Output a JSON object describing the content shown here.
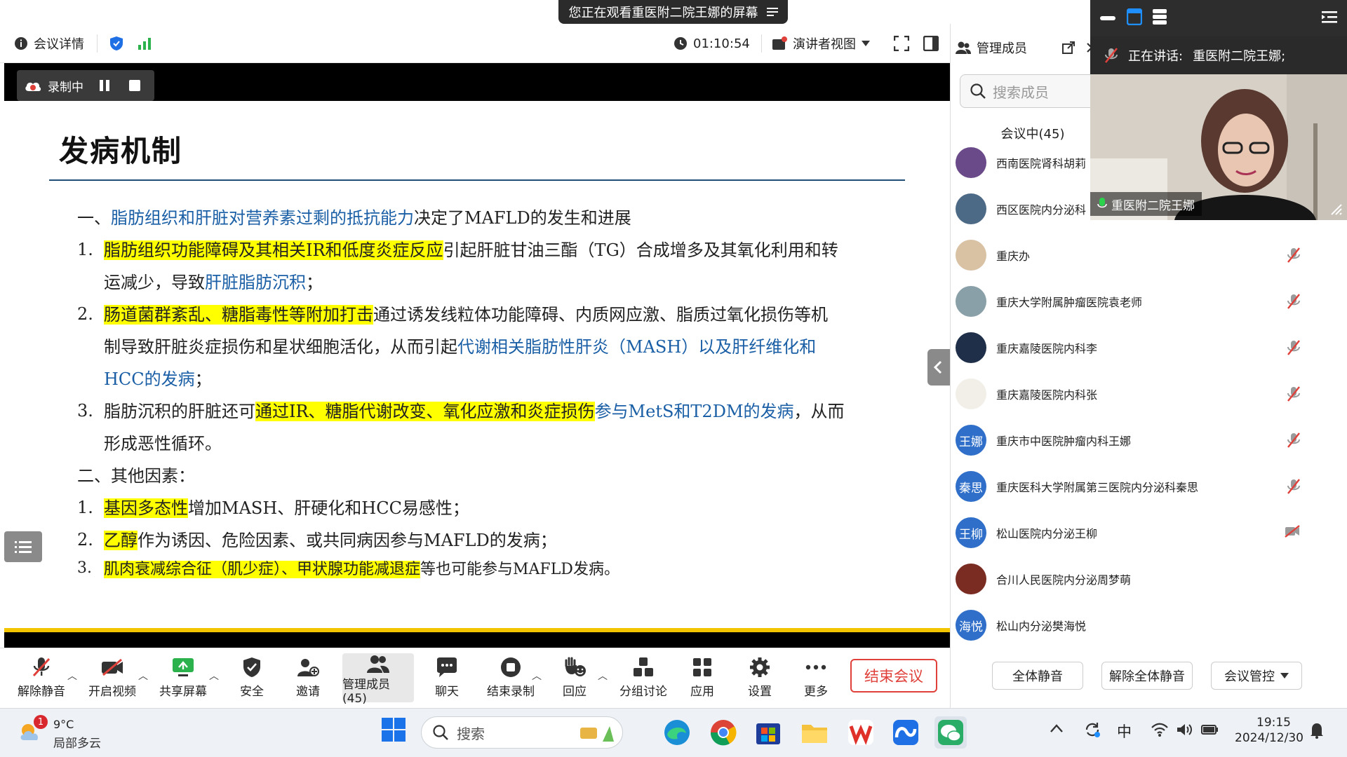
{
  "banner": {
    "text": "您正在观看重医附二院王娜的屏幕"
  },
  "topbar": {
    "meeting_info": "会议详情",
    "timer": "01:10:54",
    "view_mode": "演讲者视图"
  },
  "recording": {
    "label": "录制中"
  },
  "slide": {
    "title": "发病机制",
    "lines": {
      "s1_prefix": "一、",
      "s1_blue": "脂肪组织和肝脏对营养素过剩的抵抗能力",
      "s1_rest": "决定了MAFLD的发生和进展",
      "n1": "1.",
      "l1_hl": "脂肪组织功能障碍及其相关IR和低度炎症反应",
      "l1_rest": "引起肝脏甘油三酯（TG）合成增多及其氧化利用和转",
      "l1b_a": "运减少，导致",
      "l1b_blue": "肝脏脂肪沉积",
      "l1b_b": "；",
      "n2": "2.",
      "l2_hl": "肠道菌群紊乱、糖脂毒性等附加打击",
      "l2_rest": "通过诱发线粒体功能障碍、内质网应激、脂质过氧化损伤等机",
      "l2b_a": "制导致肝脏炎症损伤和星状细胞活化，从而引起",
      "l2b_blue": "代谢相关脂肪性肝炎（MASH）以及肝纤维化和",
      "l2c_blue": "HCC的发病",
      "l2c_b": "；",
      "n3": "3.",
      "l3_a": "脂肪沉积的肝脏还可",
      "l3_hl": "通过IR、糖脂代谢改变、氧化应激和炎症损伤",
      "l3_blue": "参与MetS和T2DM的发病",
      "l3_b": "，从而",
      "l3b": "形成恶性循环。",
      "s2": "二、其他因素：",
      "n4": "1.",
      "l4_hl": "基因多态性",
      "l4_rest": "增加MASH、肝硬化和HCC易感性；",
      "n5": "2.",
      "l5_hl": "乙醇",
      "l5_rest": "作为诱因、危险因素、或共同病因参与MAFLD的发病；",
      "n6": "3.",
      "l6_hl": "肌肉衰减综合征（肌少症）、甲状腺功能减退症",
      "l6_rest": "等也可能参与MAFLD发病。"
    }
  },
  "toolbar": {
    "unmute": "解除静音",
    "video": "开启视频",
    "share": "共享屏幕",
    "security": "安全",
    "invite": "邀请",
    "members": "管理成员(45)",
    "chat": "聊天",
    "end_record": "结束录制",
    "react": "回应",
    "breakout": "分组讨论",
    "apps": "应用",
    "settings": "设置",
    "more": "更多",
    "end_meeting": "结束会议"
  },
  "panel": {
    "title": "管理成员",
    "search_placeholder": "搜索成员",
    "tab_in_meeting": "会议中(45)",
    "members": [
      {
        "name": "西南医院肾科胡莉",
        "initials": ""
      },
      {
        "name": "西区医院内分泌科",
        "initials": ""
      },
      {
        "name": "重庆办",
        "initials": ""
      },
      {
        "name": "重庆大学附属肿瘤医院袁老师",
        "initials": ""
      },
      {
        "name": "重庆嘉陵医院内科李",
        "initials": ""
      },
      {
        "name": "重庆嘉陵医院内科张",
        "initials": ""
      },
      {
        "name": "重庆市中医院肿瘤内科王娜",
        "initials": "王娜"
      },
      {
        "name": "重庆医科大学附属第三医院内分泌科秦思",
        "initials": "秦思"
      },
      {
        "name": "松山医院内分泌王柳",
        "initials": "王柳"
      },
      {
        "name": "合川人民医院内分泌周梦萌",
        "initials": ""
      },
      {
        "name": "松山内分泌樊海悦",
        "initials": "海悦"
      }
    ],
    "mute_all": "全体静音",
    "unmute_all": "解除全体静音",
    "meeting_control": "会议管控"
  },
  "video": {
    "speaking_label": "正在讲话:",
    "speaking_name": "重医附二院王娜;",
    "video_name": "重医附二院王娜"
  },
  "taskbar": {
    "weather_temp": "9°C",
    "weather_desc": "局部多云",
    "weather_badge": "1",
    "search": "搜索",
    "ime": "中",
    "time": "19:15",
    "date": "2024/12/30"
  }
}
